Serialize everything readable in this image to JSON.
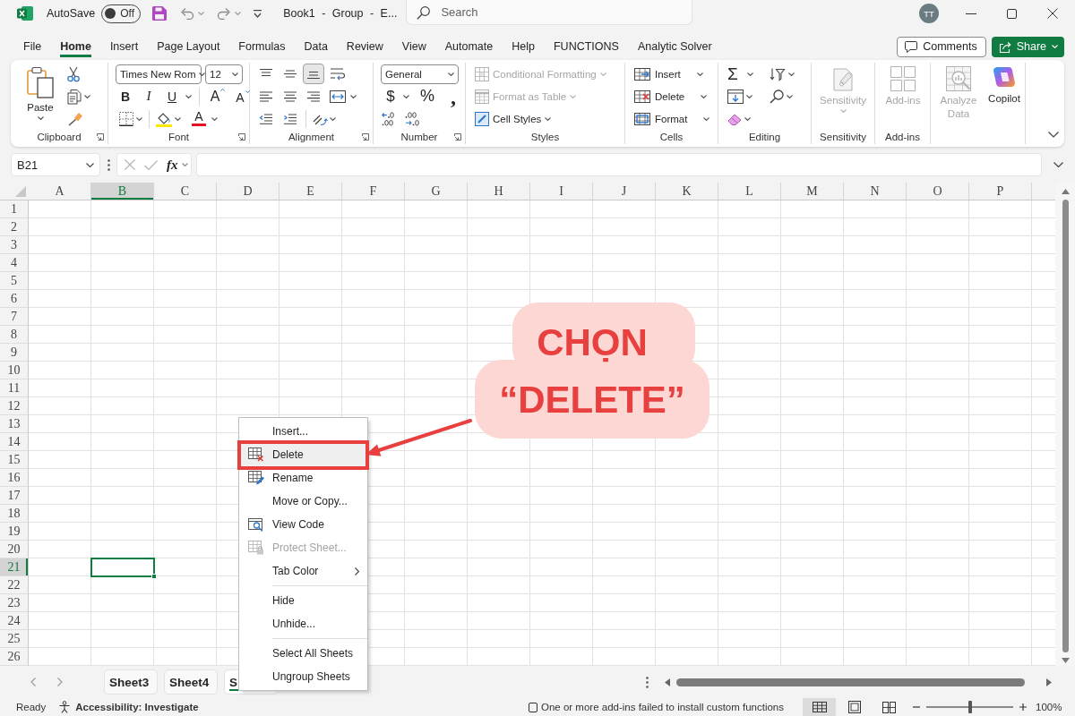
{
  "title_bar": {
    "autosave_label": "AutoSave",
    "autosave": {
      "on": false,
      "label": "Off"
    },
    "document_title": "Book1 - Group - E...",
    "search": {
      "placeholder": "Search"
    },
    "avatar": "TT"
  },
  "ribbon_tabs": [
    {
      "label": "File",
      "selected": false
    },
    {
      "label": "Home",
      "selected": true
    },
    {
      "label": "Insert",
      "selected": false
    },
    {
      "label": "Page Layout",
      "selected": false
    },
    {
      "label": "Formulas",
      "selected": false
    },
    {
      "label": "Data",
      "selected": false
    },
    {
      "label": "Review",
      "selected": false
    },
    {
      "label": "View",
      "selected": false
    },
    {
      "label": "Automate",
      "selected": false
    },
    {
      "label": "Help",
      "selected": false
    },
    {
      "label": "FUNCTIONS",
      "selected": false
    },
    {
      "label": "Analytic Solver",
      "selected": false
    }
  ],
  "comments_button": "Comments",
  "share_button": "Share",
  "ribbon": {
    "clipboard": {
      "label": "Clipboard",
      "paste": "Paste"
    },
    "font": {
      "label": "Font",
      "font_name": "Times New Rom",
      "font_size": "12",
      "bold": "B",
      "italic": "I",
      "underline": "U",
      "grow_font": "A",
      "shrink_font": "A",
      "font_color": "A"
    },
    "alignment": {
      "label": "Alignment",
      "vertical_align": [
        {
          "kind": "top",
          "selected": false
        },
        {
          "kind": "middle",
          "selected": false
        },
        {
          "kind": "bottom",
          "selected": true
        }
      ]
    },
    "number": {
      "label": "Number",
      "format": "General",
      "currency": "$",
      "percent": "%",
      "comma": ","
    },
    "styles": {
      "label": "Styles",
      "commands": [
        {
          "kind": "conditional",
          "label": "Conditional Formatting",
          "disabled": true
        },
        {
          "kind": "table",
          "label": "Format as Table",
          "disabled": true
        },
        {
          "kind": "cell_styles",
          "label": "Cell Styles",
          "disabled": false
        }
      ]
    },
    "cells": {
      "label": "Cells",
      "commands": [
        {
          "kind": "insert",
          "label": "Insert"
        },
        {
          "kind": "delete",
          "label": "Delete"
        },
        {
          "kind": "format",
          "label": "Format"
        }
      ]
    },
    "editing": {
      "label": "Editing",
      "autosum": "Σ"
    },
    "sensitivity": {
      "label": "Sensitivity",
      "button": {
        "label": "Sensitivity",
        "disabled": true
      }
    },
    "add_ins": {
      "label": "Add-ins",
      "button": {
        "label": "Add-ins",
        "disabled": true
      }
    },
    "ai_tools": [
      {
        "kind": "analyze",
        "label": "Analyze Data",
        "disabled": true
      },
      {
        "kind": "copilot",
        "label": "Copilot",
        "disabled": false
      }
    ]
  },
  "formula_bar": {
    "name_box": "B21",
    "function_button": "fx"
  },
  "sheet": {
    "columns": [
      {
        "label": "A",
        "selected": false
      },
      {
        "label": "B",
        "selected": true
      },
      {
        "label": "C",
        "selected": false
      },
      {
        "label": "D",
        "selected": false
      },
      {
        "label": "E",
        "selected": false
      },
      {
        "label": "F",
        "selected": false
      },
      {
        "label": "G",
        "selected": false
      },
      {
        "label": "H",
        "selected": false
      },
      {
        "label": "I",
        "selected": false
      },
      {
        "label": "J",
        "selected": false
      },
      {
        "label": "K",
        "selected": false
      },
      {
        "label": "L",
        "selected": false
      },
      {
        "label": "M",
        "selected": false
      },
      {
        "label": "N",
        "selected": false
      },
      {
        "label": "O",
        "selected": false
      },
      {
        "label": "P",
        "selected": false
      }
    ],
    "rows": [
      {
        "label": "1",
        "selected": false
      },
      {
        "label": "2",
        "selected": false
      },
      {
        "label": "3",
        "selected": false
      },
      {
        "label": "4",
        "selected": false
      },
      {
        "label": "5",
        "selected": false
      },
      {
        "label": "6",
        "selected": false
      },
      {
        "label": "7",
        "selected": false
      },
      {
        "label": "8",
        "selected": false
      },
      {
        "label": "9",
        "selected": false
      },
      {
        "label": "10",
        "selected": false
      },
      {
        "label": "11",
        "selected": false
      },
      {
        "label": "12",
        "selected": false
      },
      {
        "label": "13",
        "selected": false
      },
      {
        "label": "14",
        "selected": false
      },
      {
        "label": "15",
        "selected": false
      },
      {
        "label": "16",
        "selected": false
      },
      {
        "label": "17",
        "selected": false
      },
      {
        "label": "18",
        "selected": false
      },
      {
        "label": "19",
        "selected": false
      },
      {
        "label": "20",
        "selected": false
      },
      {
        "label": "21",
        "selected": true
      },
      {
        "label": "22",
        "selected": false
      },
      {
        "label": "23",
        "selected": false
      },
      {
        "label": "24",
        "selected": false
      },
      {
        "label": "25",
        "selected": false
      },
      {
        "label": "26",
        "selected": false
      }
    ]
  },
  "sheet_tabs": [
    {
      "label": "Sheet3",
      "selected": false
    },
    {
      "label": "Sheet4",
      "selected": false
    },
    {
      "label": "S",
      "selected": true
    }
  ],
  "status_bar": {
    "mode": "Ready",
    "accessibility": "Accessibility: Investigate",
    "message": "One or more add-ins failed to install custom functions",
    "views": [
      {
        "kind": "normal",
        "selected": true
      },
      {
        "kind": "page_layout",
        "selected": false
      },
      {
        "kind": "page_break",
        "selected": false
      }
    ],
    "zoom": {
      "level": 0.5,
      "reading": "100%"
    }
  },
  "context_menu": {
    "groups": [
      {
        "items": [
          {
            "label": "Insert...",
            "kind": "plain",
            "selected": false,
            "disabled": false
          },
          {
            "label": "Delete",
            "kind": "delete",
            "selected": true,
            "disabled": false
          },
          {
            "label": "Rename",
            "kind": "rename",
            "selected": false,
            "disabled": false
          },
          {
            "label": "Move or Copy...",
            "kind": "plain",
            "selected": false,
            "disabled": false
          },
          {
            "label": "View Code",
            "kind": "view_code",
            "selected": false,
            "disabled": false
          },
          {
            "label": "Protect Sheet...",
            "kind": "protect",
            "selected": false,
            "disabled": true
          },
          {
            "label": "Tab Color",
            "kind": "submenu",
            "selected": false,
            "disabled": false
          }
        ]
      },
      {
        "items": [
          {
            "label": "Hide",
            "kind": "plain",
            "selected": false,
            "disabled": false
          },
          {
            "label": "Unhide...",
            "kind": "plain",
            "selected": false,
            "disabled": false
          }
        ]
      },
      {
        "items": [
          {
            "label": "Select All Sheets",
            "kind": "plain",
            "selected": false,
            "disabled": false
          },
          {
            "label": "Ungroup Sheets",
            "kind": "plain",
            "selected": false,
            "disabled": false
          }
        ]
      }
    ]
  },
  "annotation": {
    "callout": [
      "CHỌN",
      "“DELETE”"
    ]
  }
}
